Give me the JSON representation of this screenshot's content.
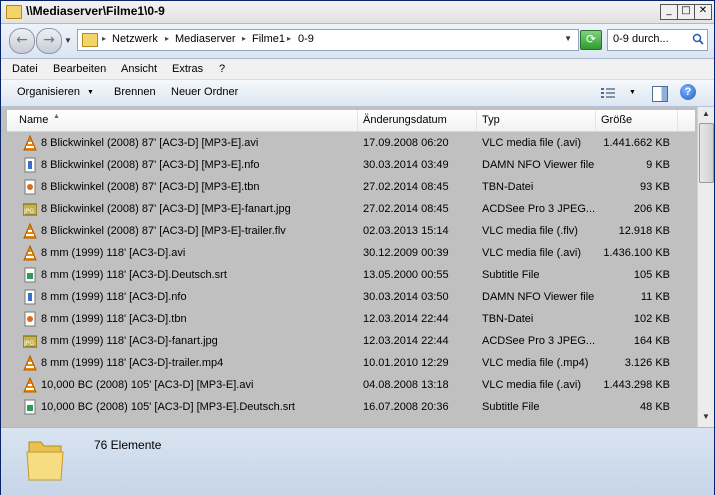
{
  "window": {
    "title": "\\\\Mediaserver\\Filme1\\0-9"
  },
  "address": {
    "crumbs": [
      "Netzwerk",
      "Mediaserver",
      "Filme1",
      "0-9"
    ],
    "search_value": "0-9 durch..."
  },
  "menu": [
    "Datei",
    "Bearbeiten",
    "Ansicht",
    "Extras",
    "?"
  ],
  "toolbar": {
    "organize": "Organisieren",
    "burn": "Brennen",
    "new_folder": "Neuer Ordner"
  },
  "columns": {
    "name": "Name",
    "date": "Änderungsdatum",
    "type": "Typ",
    "size": "Größe"
  },
  "files": [
    {
      "icon": "vlc-icon",
      "name": "8 Blickwinkel (2008) 87' [AC3-D] [MP3-E].avi",
      "date": "17.09.2008 06:20",
      "type": "VLC media file (.avi)",
      "size": "1.441.662 KB"
    },
    {
      "icon": "nfo-icon",
      "name": "8 Blickwinkel (2008) 87' [AC3-D] [MP3-E].nfo",
      "date": "30.03.2014 03:49",
      "type": "DAMN NFO Viewer file",
      "size": "9 KB"
    },
    {
      "icon": "tbn-icon",
      "name": "8 Blickwinkel (2008) 87' [AC3-D] [MP3-E].tbn",
      "date": "27.02.2014 08:45",
      "type": "TBN-Datei",
      "size": "93 KB"
    },
    {
      "icon": "jpg-icon",
      "name": "8 Blickwinkel (2008) 87' [AC3-D] [MP3-E]-fanart.jpg",
      "date": "27.02.2014 08:45",
      "type": "ACDSee Pro 3 JPEG...",
      "size": "206 KB"
    },
    {
      "icon": "vlc-icon",
      "name": "8 Blickwinkel (2008) 87' [AC3-D] [MP3-E]-trailer.flv",
      "date": "02.03.2013 15:14",
      "type": "VLC media file (.flv)",
      "size": "12.918 KB"
    },
    {
      "icon": "vlc-icon",
      "name": "8 mm (1999) 118' [AC3-D].avi",
      "date": "30.12.2009 00:39",
      "type": "VLC media file (.avi)",
      "size": "1.436.100 KB"
    },
    {
      "icon": "srt-icon",
      "name": "8 mm (1999) 118' [AC3-D].Deutsch.srt",
      "date": "13.05.2000 00:55",
      "type": "Subtitle File",
      "size": "105 KB"
    },
    {
      "icon": "nfo-icon",
      "name": "8 mm (1999) 118' [AC3-D].nfo",
      "date": "30.03.2014 03:50",
      "type": "DAMN NFO Viewer file",
      "size": "11 KB"
    },
    {
      "icon": "tbn-icon",
      "name": "8 mm (1999) 118' [AC3-D].tbn",
      "date": "12.03.2014 22:44",
      "type": "TBN-Datei",
      "size": "102 KB"
    },
    {
      "icon": "jpg-icon",
      "name": "8 mm (1999) 118' [AC3-D]-fanart.jpg",
      "date": "12.03.2014 22:44",
      "type": "ACDSee Pro 3 JPEG...",
      "size": "164 KB"
    },
    {
      "icon": "vlc-icon",
      "name": "8 mm (1999) 118' [AC3-D]-trailer.mp4",
      "date": "10.01.2010 12:29",
      "type": "VLC media file (.mp4)",
      "size": "3.126 KB"
    },
    {
      "icon": "vlc-icon",
      "name": "10,000 BC (2008) 105' [AC3-D] [MP3-E].avi",
      "date": "04.08.2008 13:18",
      "type": "VLC media file (.avi)",
      "size": "1.443.298 KB"
    },
    {
      "icon": "srt-icon",
      "name": "10,000 BC (2008) 105' [AC3-D] [MP3-E].Deutsch.srt",
      "date": "16.07.2008 20:36",
      "type": "Subtitle File",
      "size": "48 KB"
    }
  ],
  "status": {
    "count": "76 Elemente"
  }
}
